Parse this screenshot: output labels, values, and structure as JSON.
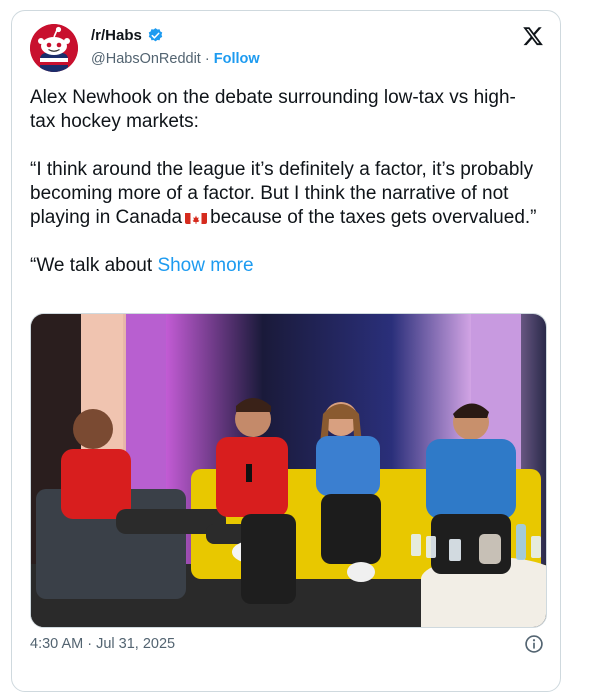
{
  "account": {
    "display_name": "/r/Habs",
    "handle": "@HabsOnReddit",
    "separator": "·",
    "follow_label": "Follow"
  },
  "tweet": {
    "paragraph_1": "Alex Newhook on the debate surrounding low-tax vs high-tax hockey markets:",
    "paragraph_2a": "“I think around the league it’s definitely a factor, it’s probably becoming more of a factor. But I think the narrative of not playing in Canada",
    "paragraph_2b": "because of the taxes gets overvalued.”",
    "paragraph_3": "“We talk about ",
    "show_more": "Show more"
  },
  "meta": {
    "timestamp": "4:30 AM · Jul 31, 2025"
  },
  "icons": {
    "verified": "verified-badge-icon",
    "x_logo": "x-logo-icon",
    "info": "info-icon",
    "flag": "canada-flag-icon"
  },
  "colors": {
    "link": "#1d9bf0",
    "text": "#0f1419",
    "secondary": "#536471",
    "border": "#cfd9de",
    "avatar_bg": "#c8102e"
  }
}
